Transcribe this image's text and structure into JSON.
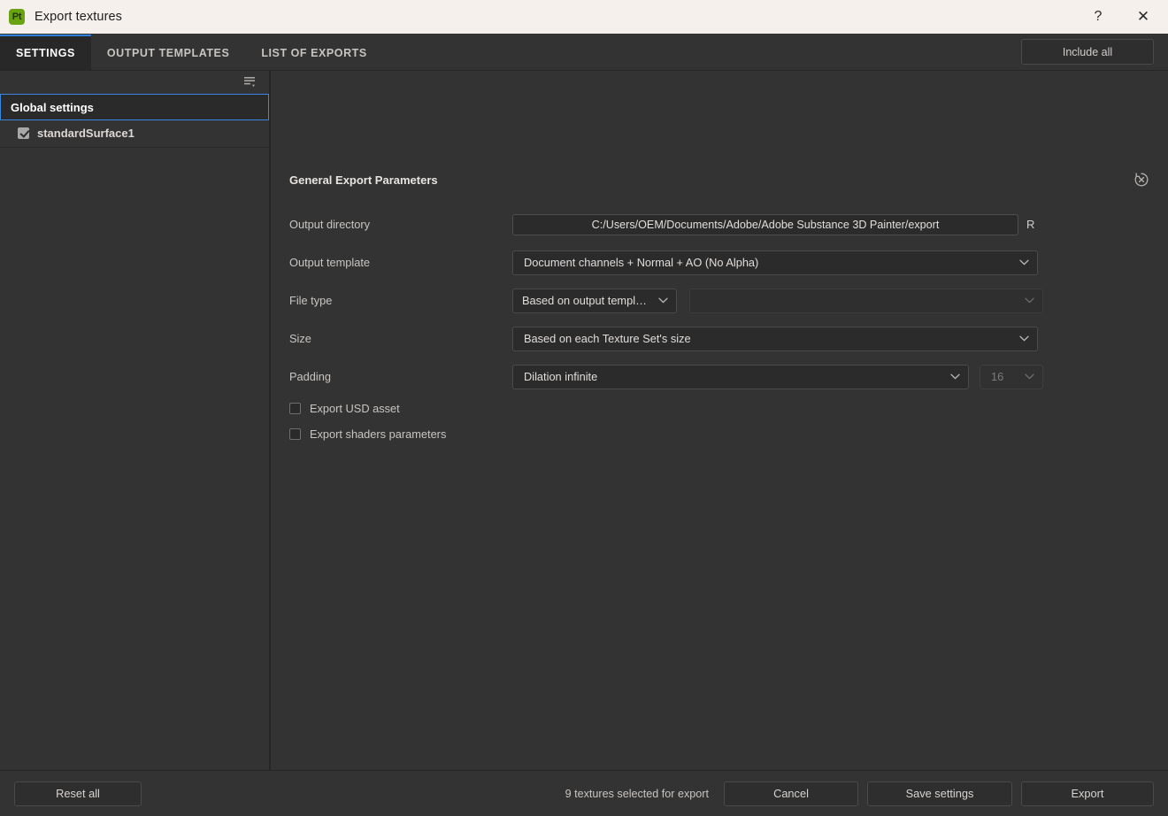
{
  "window": {
    "title": "Export textures",
    "app_icon_label": "Pt",
    "help_label": "?",
    "close_label": "✕",
    "accent_color": "#2f80d8",
    "titlebar_bg": "#f6f0ec",
    "panel_bg": "#333333"
  },
  "tabs": [
    {
      "label": "SETTINGS",
      "active": true
    },
    {
      "label": "OUTPUT TEMPLATES",
      "active": false
    },
    {
      "label": "LIST OF EXPORTS",
      "active": false
    }
  ],
  "toolbar": {
    "include_all_label": "Include all"
  },
  "sidebar": {
    "filter_icon": "list-filter-icon",
    "items": [
      {
        "label": "Global settings",
        "selected": true,
        "has_checkbox": false
      },
      {
        "label": "standardSurface1",
        "selected": false,
        "has_checkbox": true,
        "checked": true
      }
    ]
  },
  "main": {
    "section_title": "General Export Parameters",
    "reset_icon": "reset-circle-icon",
    "fields": {
      "output_directory": {
        "label": "Output directory",
        "value": "C:/Users/OEM/Documents/Adobe/Adobe Substance 3D Painter/export",
        "browse_label": "R"
      },
      "output_template": {
        "label": "Output template",
        "value": "Document channels + Normal + AO (No Alpha)"
      },
      "file_type": {
        "label": "File type",
        "value": "Based on output template",
        "secondary_value": ""
      },
      "size": {
        "label": "Size",
        "value": "Based on each Texture Set's size"
      },
      "padding": {
        "label": "Padding",
        "value": "Dilation infinite",
        "amount": "16"
      }
    },
    "checkboxes": [
      {
        "label": "Export USD asset",
        "checked": false
      },
      {
        "label": "Export shaders parameters",
        "checked": false
      }
    ]
  },
  "footer": {
    "reset_all_label": "Reset all",
    "status": "9 textures selected for export",
    "cancel_label": "Cancel",
    "save_settings_label": "Save settings",
    "export_label": "Export"
  }
}
